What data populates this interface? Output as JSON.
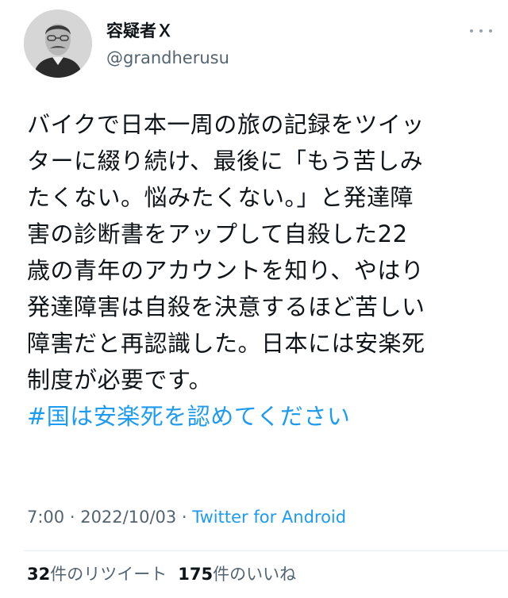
{
  "author": {
    "display_name": "容疑者Ｘ",
    "handle": "@grandherusu",
    "avatar_icon": "user-avatar-icon"
  },
  "tweet": {
    "lines": [
      "バイクで日本一周の旅の記録をツイッ",
      "ターに綴り続け、最後に「もう苦しみ",
      "たくない。悩みたくない。」と発達障",
      "害の診断書をアップして自殺した22",
      "歳の青年のアカウントを知り、やはり",
      "発達障害は自殺を決意するほど苦しい",
      "障害だと再認識した。日本には安楽死",
      "制度が必要です。"
    ],
    "hashtag": "#国は安楽死を認めてください"
  },
  "meta": {
    "time": "7:00",
    "separator": " · ",
    "date": "2022/10/03",
    "source": "Twitter for Android"
  },
  "stats": {
    "retweets_count": "32",
    "retweets_label": "件のリツイート",
    "likes_count": "175",
    "likes_label": "件のいいね"
  },
  "colors": {
    "link": "#1d9bf0",
    "secondary_text": "#536471",
    "primary_text": "#0f1419"
  },
  "icons": {
    "more": "more-options-icon"
  }
}
